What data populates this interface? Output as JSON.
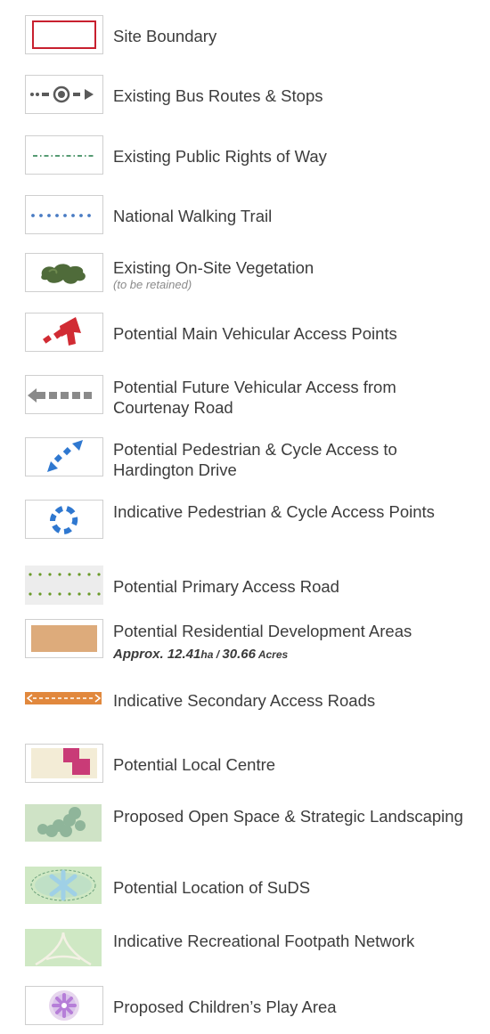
{
  "legend": {
    "items": [
      {
        "label": "Site Boundary",
        "icon": "site-boundary-icon"
      },
      {
        "label": "Existing Bus Routes & Stops",
        "icon": "bus-route-icon"
      },
      {
        "label": "Existing Public Rights of Way",
        "icon": "rights-of-way-icon"
      },
      {
        "label": "National Walking Trail",
        "icon": "walking-trail-icon"
      },
      {
        "label": "Existing On-Site Vegetation",
        "note": "(to be retained)",
        "icon": "vegetation-icon"
      },
      {
        "label": "Potential Main Vehicular Access Points",
        "icon": "main-access-arrow-icon"
      },
      {
        "label": "Potential Future Vehicular Access from Courtenay Road",
        "icon": "future-access-arrow-icon"
      },
      {
        "label": "Potential Pedestrian & Cycle Access to Hardington Drive",
        "icon": "pedestrian-access-arrow-icon"
      },
      {
        "label": "Indicative Pedestrian & Cycle Access Points",
        "icon": "access-points-ring-icon"
      },
      {
        "label": "Potential Primary Access Road",
        "icon": "primary-road-icon"
      },
      {
        "label": "Potential Residential Development Areas",
        "icon": "residential-area-icon",
        "area_prefix": "Approx. ",
        "area_ha_value": "12.41",
        "area_ha_unit": "ha / ",
        "area_acres_value": "30.66",
        "area_acres_unit": " Acres"
      },
      {
        "label": "Indicative Secondary Access Roads",
        "icon": "secondary-road-icon"
      },
      {
        "label": "Potential Local Centre",
        "icon": "local-centre-icon"
      },
      {
        "label": "Proposed Open Space & Strategic Landscaping",
        "icon": "open-space-icon"
      },
      {
        "label": "Potential Location of SuDS",
        "icon": "suds-icon"
      },
      {
        "label": "Indicative Recreational Footpath Network",
        "icon": "footpath-network-icon"
      },
      {
        "label": "Proposed Children’s Play Area",
        "icon": "play-area-icon"
      }
    ]
  },
  "colors": {
    "site_boundary": "#c8202f",
    "bus_route": "#5a5a5a",
    "rights_of_way": "#1f7a45",
    "walking_trail": "#4a7cc4",
    "vegetation": "#4f6b3a",
    "main_access": "#d12b33",
    "future_access": "#8a8a8a",
    "pedestrian_access": "#2f78d0",
    "primary_road": "#6a9a2a",
    "residential": "#ddab7b",
    "secondary_road": "#e1883d",
    "local_centre_bg": "#f3ecd6",
    "local_centre": "#c93b77",
    "open_space": "#cfe3c6",
    "suds": "#9fd0e6",
    "footpath_bg": "#cfe8c4",
    "play_area": "#b67ed8"
  }
}
